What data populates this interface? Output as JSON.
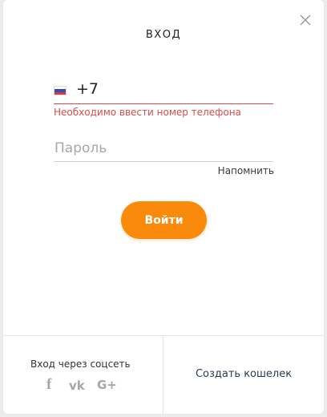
{
  "modal": {
    "title": "ВХОД",
    "close_icon": "close-icon"
  },
  "phone": {
    "flag_icon": "russia-flag-icon",
    "value": "+7",
    "error": "Необходимо ввести номер телефона",
    "error_color": "#d94a4a"
  },
  "password": {
    "placeholder": "Пароль"
  },
  "remind_label": "Напомнить",
  "login_button": {
    "label": "Войти",
    "color": "#fa8a0c"
  },
  "footer": {
    "social_label": "Вход через соцсеть",
    "social_icons": [
      {
        "name": "facebook-icon",
        "glyph": "f"
      },
      {
        "name": "vk-icon",
        "glyph": "vk"
      },
      {
        "name": "google-plus-icon",
        "glyph": "G+"
      }
    ],
    "create_wallet": "Создать кошелек"
  }
}
